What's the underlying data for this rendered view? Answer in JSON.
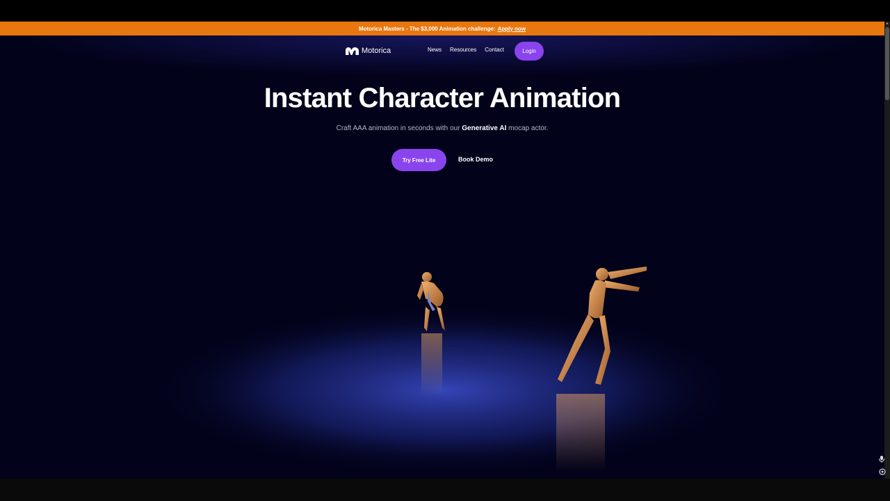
{
  "banner": {
    "text": "Motorica Masters - The $3,000 Animation challenge:",
    "link": "Apply now"
  },
  "nav": {
    "logo_text": "Motorica",
    "links": [
      "News",
      "Resources",
      "Contact"
    ],
    "login": "Login"
  },
  "hero": {
    "title": "Instant Character Animation",
    "subtitle_pre": "Craft AAA animation in seconds with our",
    "subtitle_bold": "Generative AI",
    "subtitle_post": "mocap actor.",
    "primary_cta": "Try Free Lite",
    "secondary_cta": "Book Demo"
  },
  "colors": {
    "banner": "#e8770f",
    "accent": "#8a44ee",
    "background": "#02021a"
  }
}
